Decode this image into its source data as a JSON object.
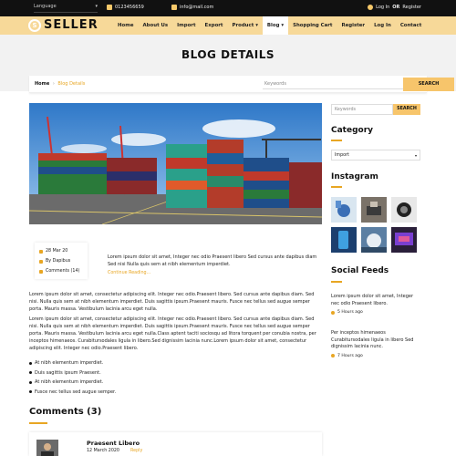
{
  "topbar": {
    "language_label": "Language",
    "phone": "0123456659",
    "email": "info@mail.com",
    "login": "Log In",
    "or": "OR",
    "register": "Register"
  },
  "brand": {
    "logo_letter": "S",
    "name": "SELLER"
  },
  "menu": [
    {
      "label": "Home"
    },
    {
      "label": "About Us"
    },
    {
      "label": "Import"
    },
    {
      "label": "Export"
    },
    {
      "label": "Product"
    },
    {
      "label": "Blog"
    },
    {
      "label": "Shopping Cart"
    },
    {
      "label": "Register"
    },
    {
      "label": "Log In"
    },
    {
      "label": "Contact"
    }
  ],
  "page_title": "BLOG DETAILS",
  "breadcrumb": {
    "home": "Home",
    "current": "Blog Details"
  },
  "search": {
    "placeholder": "Keywords",
    "button": "SEARCH"
  },
  "post": {
    "date": "28 Mar 20",
    "author": "By Dapibus",
    "comments": "Comments (14)",
    "intro": "Lorem ipsum dolor sit amet, Integer nec odio Praesent libero Sed cursus ante dapibus diam Sed nisi Nulla quis sem at nibh elementum imperdiet.",
    "continue": "Continue Reading...",
    "para1": "Lorem ipsum dolor sit amet, consectetur adipiscing elit. Integer nec odio.Praesent libero. Sed cursus ante dapibus diam. Sed nisi. Nulla quis sem at nibh elementum imperdiet. Duis sagittis ipsum.Praesent mauris. Fusce nec tellus sed augue semper porta. Mauris massa. Vestibulum lacinia arcu eget nulla.",
    "para2": "Lorem ipsum dolor sit amet, consectetur adipiscing elit. Integer nec odio.Praesent libero. Sed cursus ante dapibus diam. Sed nisi. Nulla quis sem at nibh elementum imperdiet. Duis sagittis ipsum.Praesent mauris. Fusce nec tellus sed augue semper porta. Mauris massa. Vestibulum lacinia arcu eget nulla.Class aptent taciti sociosqu ad litora torquent per conubia nostra, per inceptos himenaeos. Curabitursodales ligula in libero.Sed dignissim lacinia nunc.Lorem ipsum dolor sit amet, consectetur adipiscing elit. Integer nec odio.Praesent libero.",
    "bullets": [
      "At nibh elementum imperdiet.",
      "Duis sagittis ipsum Praesent.",
      "At nibh elementum imperdiet.",
      "Fusce nec tellus sed augue semper."
    ]
  },
  "comments": {
    "heading": "Comments (3)",
    "first": {
      "name": "Praesent Libero",
      "date": "12 March 2020",
      "reply": "Reply"
    }
  },
  "sidebar": {
    "search_placeholder": "Keywords",
    "search_button": "SEARCH",
    "category_heading": "Category",
    "category_selected": "Import",
    "instagram_heading": "Instagram",
    "social_heading": "Social Feeds",
    "feeds": [
      {
        "text": "Lorem ipsum dolor sit amet, Integer nec odio Praesent libero.",
        "time": "5 Hours ago"
      },
      {
        "text": "Per inceptos himenaeos Curabitursodales ligula in libero Sed dignissim lacinia nunc.",
        "time": "7 Hours ago"
      }
    ]
  },
  "colors": {
    "accent": "#e8a623",
    "nav_bg": "#f7d999",
    "topbar_bg": "#111111",
    "button": "#f7c56b"
  }
}
